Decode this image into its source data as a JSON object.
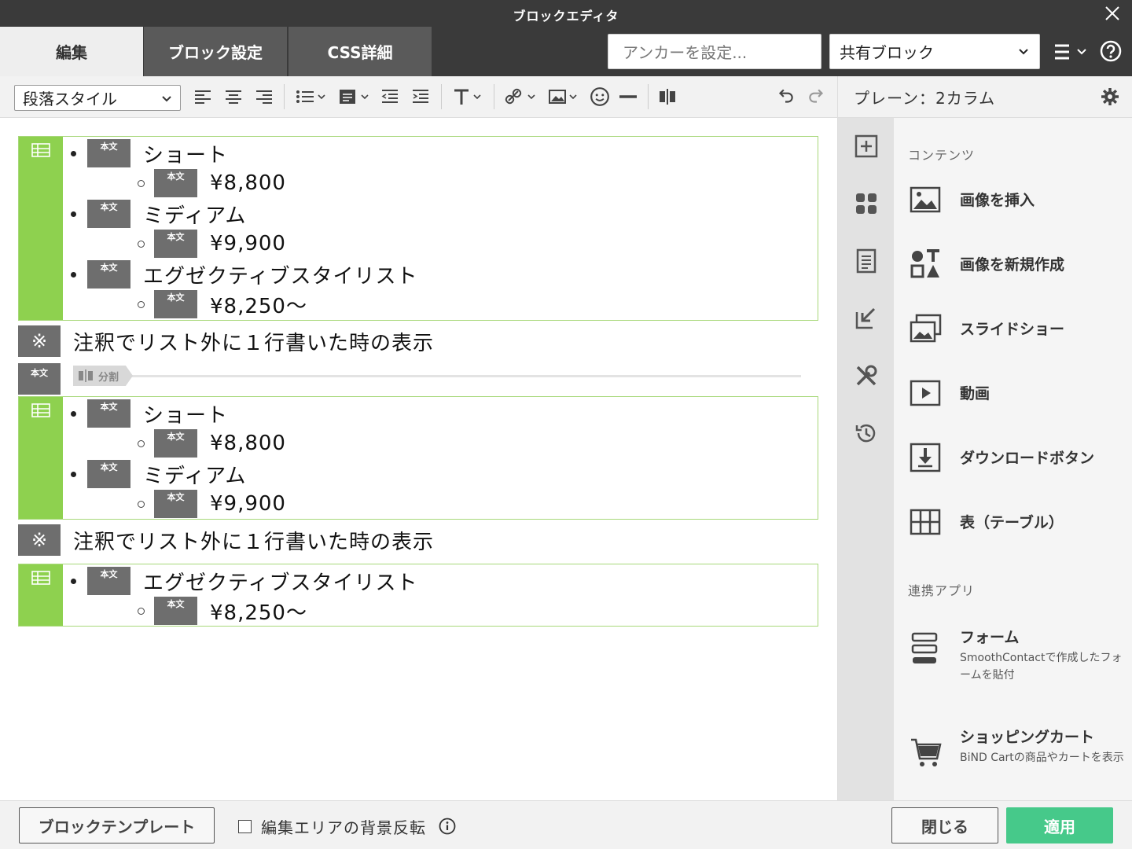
{
  "window": {
    "title": "ブロックエディタ"
  },
  "tabs": [
    {
      "label": "編集"
    },
    {
      "label": "ブロック設定"
    },
    {
      "label": "CSS詳細"
    }
  ],
  "anchor": {
    "placeholder": "アンカーを設定..."
  },
  "shared_block": {
    "selected": "共有ブロック"
  },
  "toolbar": {
    "paragraph_style": "段落スタイル"
  },
  "right_header": {
    "title": "プレーン：2カラム"
  },
  "blocks": {
    "badge": "本文",
    "note_mark": "※",
    "list1": {
      "items": [
        {
          "label": "ショート",
          "price": "¥8,800"
        },
        {
          "label": "ミディアム",
          "price": "¥9,900"
        },
        {
          "label": "エグゼクティブスタイリスト",
          "price": "¥8,250〜"
        }
      ]
    },
    "note1": "注釈でリスト外に１行書いた時の表示",
    "split_label": "分割",
    "list2": {
      "items": [
        {
          "label": "ショート",
          "price": "¥8,800"
        },
        {
          "label": "ミディアム",
          "price": "¥9,900"
        }
      ]
    },
    "note2": "注釈でリスト外に１行書いた時の表示",
    "list3": {
      "items": [
        {
          "label": "エグゼクティブスタイリスト",
          "price": "¥8,250〜"
        }
      ]
    }
  },
  "panel": {
    "section_contents": "コンテンツ",
    "items": [
      {
        "label": "画像を挿入",
        "icon": "image-icon"
      },
      {
        "label": "画像を新規作成",
        "icon": "shapes-icon"
      },
      {
        "label": "スライドショー",
        "icon": "slideshow-icon"
      },
      {
        "label": "動画",
        "icon": "video-icon"
      },
      {
        "label": "ダウンロードボタン",
        "icon": "download-icon"
      },
      {
        "label": "表（テーブル）",
        "icon": "table-icon"
      }
    ],
    "section_apps": "連携アプリ",
    "apps": [
      {
        "label": "フォーム",
        "desc": "SmoothContactで作成したフォームを貼付",
        "icon": "form-icon"
      },
      {
        "label": "ショッピングカート",
        "desc": "BiND Cartの商品やカートを表示",
        "icon": "cart-icon"
      }
    ]
  },
  "footer": {
    "template_button": "ブロックテンプレート",
    "invert_label": "編集エリアの背景反転",
    "close_button": "閉じる",
    "apply_button": "適用"
  },
  "colors": {
    "accent_green": "#8ed14f",
    "apply_green": "#46c98a",
    "titlebar": "#3a3a3a"
  }
}
